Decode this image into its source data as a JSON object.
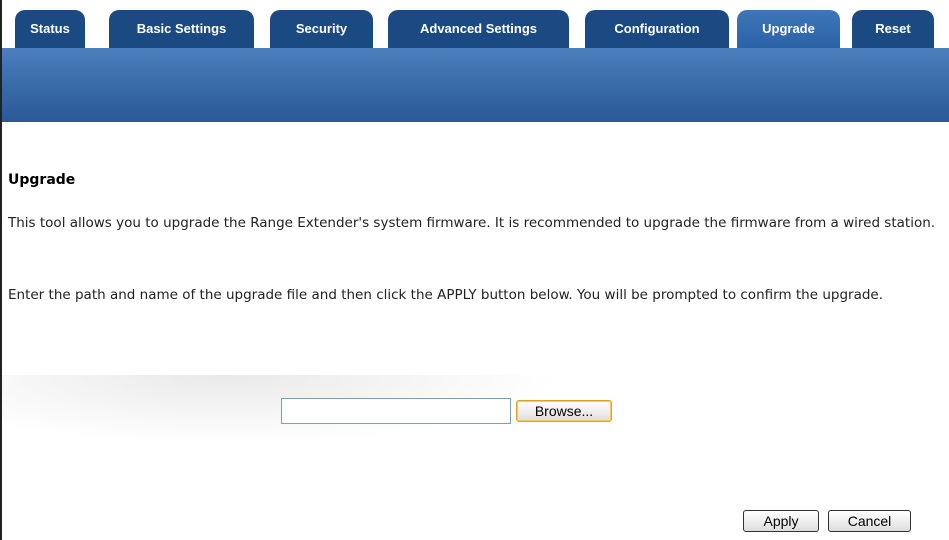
{
  "tabs": [
    {
      "label": "Status",
      "active": false
    },
    {
      "label": "Basic Settings",
      "active": false
    },
    {
      "label": "Security",
      "active": false
    },
    {
      "label": "Advanced Settings",
      "active": false
    },
    {
      "label": "Configuration",
      "active": false
    },
    {
      "label": "Upgrade",
      "active": true
    },
    {
      "label": "Reset",
      "active": false
    }
  ],
  "main": {
    "title": "Upgrade",
    "paragraph1": "This tool allows you to upgrade the Range Extender's system firmware. It is recommended to upgrade the firmware from a wired station.",
    "paragraph2": "Enter the path and name of the upgrade file and then click the APPLY button below. You will be prompted to confirm the upgrade."
  },
  "file": {
    "value": "",
    "browse_label": "Browse..."
  },
  "actions": {
    "apply_label": "Apply",
    "cancel_label": "Cancel"
  },
  "colors": {
    "tab_bg": "#1b4a82",
    "tab_active_bg": "#3e77b8",
    "banner": "#3b6dab"
  }
}
